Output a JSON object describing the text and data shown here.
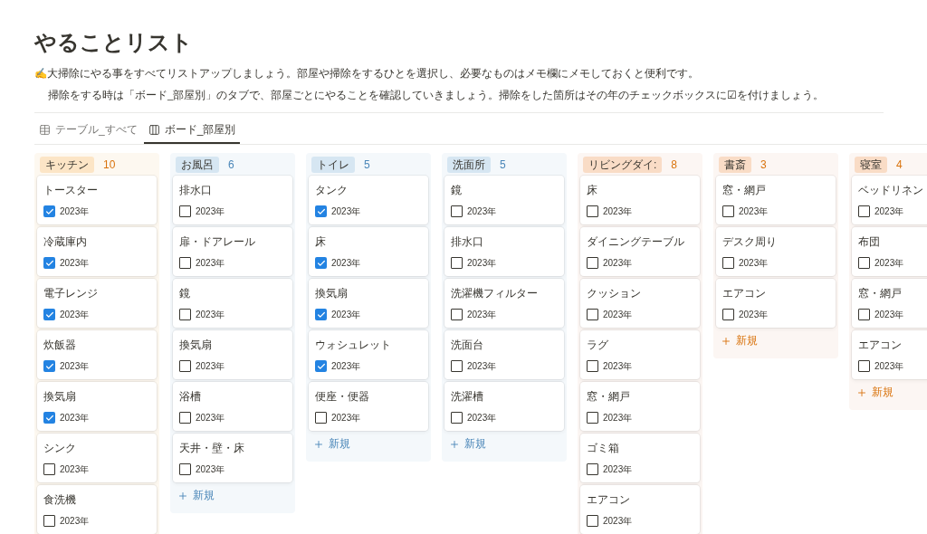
{
  "page": {
    "title": "やることリスト",
    "description": [
      "✍大掃除にやる事をすべてリストアップしましょう。部屋や掃除をするひとを選択し、必要なものはメモ欄にメモしておくと便利です。",
      "掃除をする時は「ボード_部屋別」のタブで、部屋ごとにやることを確認していきましょう。掃除をした箇所はその年のチェックボックスに☑を付けましょう。"
    ]
  },
  "tabs": [
    {
      "label": "テーブル_すべて",
      "kind": "table",
      "selected": false
    },
    {
      "label": "ボード_部屋別",
      "kind": "board",
      "selected": true
    }
  ],
  "board": {
    "columns": [
      {
        "name": "キッチン",
        "count": "10",
        "color": "#fce5c6",
        "cards": [
          {
            "title": "トースター",
            "year": "2023年",
            "checked": true
          },
          {
            "title": "冷蔵庫内",
            "year": "2023年",
            "checked": true
          },
          {
            "title": "電子レンジ",
            "year": "2023年",
            "checked": true
          },
          {
            "title": "炊飯器",
            "year": "2023年",
            "checked": true
          },
          {
            "title": "換気扇",
            "year": "2023年",
            "checked": true
          },
          {
            "title": "シンク",
            "year": "2023年",
            "checked": false
          },
          {
            "title": "食洗機",
            "year": "2023年",
            "checked": false
          }
        ]
      },
      {
        "name": "お風呂",
        "count": "6",
        "color": "#d6e6f2",
        "new_label": "新規",
        "cards": [
          {
            "title": "排水口",
            "year": "2023年",
            "checked": false
          },
          {
            "title": "扉・ドアレール",
            "year": "2023年",
            "checked": false
          },
          {
            "title": "鏡",
            "year": "2023年",
            "checked": false
          },
          {
            "title": "換気扇",
            "year": "2023年",
            "checked": false
          },
          {
            "title": "浴槽",
            "year": "2023年",
            "checked": false
          },
          {
            "title": "天井・壁・床",
            "year": "2023年",
            "checked": false
          }
        ]
      },
      {
        "name": "トイレ",
        "count": "5",
        "color": "#d6e6f2",
        "new_label": "新規",
        "cards": [
          {
            "title": "タンク",
            "year": "2023年",
            "checked": true
          },
          {
            "title": "床",
            "year": "2023年",
            "checked": true
          },
          {
            "title": "換気扇",
            "year": "2023年",
            "checked": true
          },
          {
            "title": "ウォシュレット",
            "year": "2023年",
            "checked": true
          },
          {
            "title": "便座・便器",
            "year": "2023年",
            "checked": false
          }
        ]
      },
      {
        "name": "洗面所",
        "count": "5",
        "color": "#d6e6f2",
        "new_label": "新規",
        "cards": [
          {
            "title": "鏡",
            "year": "2023年",
            "checked": false
          },
          {
            "title": "排水口",
            "year": "2023年",
            "checked": false
          },
          {
            "title": "洗濯機フィルター",
            "year": "2023年",
            "checked": false
          },
          {
            "title": "洗面台",
            "year": "2023年",
            "checked": false
          },
          {
            "title": "洗濯槽",
            "year": "2023年",
            "checked": false
          }
        ]
      },
      {
        "name": "リビングダイ:",
        "count": "8",
        "color": "#f9dcc6",
        "cards": [
          {
            "title": "床",
            "year": "2023年",
            "checked": false
          },
          {
            "title": "ダイニングテーブル",
            "year": "2023年",
            "checked": false
          },
          {
            "title": "クッション",
            "year": "2023年",
            "checked": false
          },
          {
            "title": "ラグ",
            "year": "2023年",
            "checked": false
          },
          {
            "title": "窓・網戸",
            "year": "2023年",
            "checked": false
          },
          {
            "title": "ゴミ箱",
            "year": "2023年",
            "checked": false
          },
          {
            "title": "エアコン",
            "year": "2023年",
            "checked": false
          }
        ]
      },
      {
        "name": "書斎",
        "count": "3",
        "color": "#f9dcc6",
        "new_label": "新規",
        "cards": [
          {
            "title": "窓・網戸",
            "year": "2023年",
            "checked": false
          },
          {
            "title": "デスク周り",
            "year": "2023年",
            "checked": false
          },
          {
            "title": "エアコン",
            "year": "2023年",
            "checked": false
          }
        ]
      },
      {
        "name": "寝室",
        "count": "4",
        "color": "#f9dcc6",
        "new_label": "新規",
        "cards": [
          {
            "title": "ベッドリネン",
            "year": "2023年",
            "checked": false
          },
          {
            "title": "布団",
            "year": "2023年",
            "checked": false
          },
          {
            "title": "窓・網戸",
            "year": "2023年",
            "checked": false
          },
          {
            "title": "エアコン",
            "year": "2023年",
            "checked": false
          }
        ]
      }
    ]
  }
}
